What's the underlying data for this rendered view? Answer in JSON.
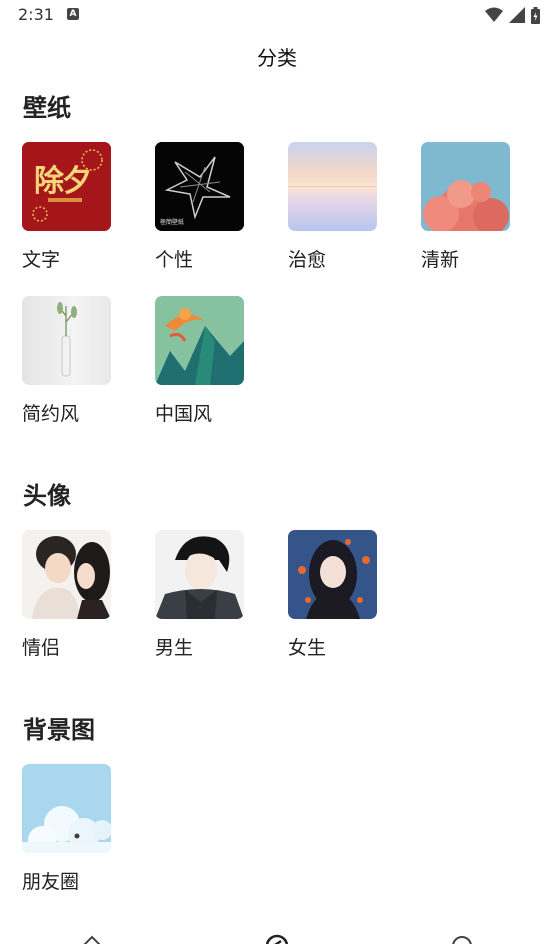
{
  "status": {
    "time": "2:31",
    "notif": "A"
  },
  "page_title": "分类",
  "sections": [
    {
      "title": "壁纸",
      "items": [
        {
          "label": "文字"
        },
        {
          "label": "个性"
        },
        {
          "label": "治愈"
        },
        {
          "label": "清新"
        },
        {
          "label": "简约风"
        },
        {
          "label": "中国风"
        }
      ]
    },
    {
      "title": "头像",
      "items": [
        {
          "label": "情侣"
        },
        {
          "label": "男生"
        },
        {
          "label": "女生"
        }
      ]
    },
    {
      "title": "背景图",
      "items": [
        {
          "label": "朋友圈"
        }
      ]
    }
  ],
  "thumb_text": {
    "chuxi": "除夕",
    "geixing_caption": "極簡壁紙"
  },
  "colors": {
    "accent": "#222222"
  }
}
